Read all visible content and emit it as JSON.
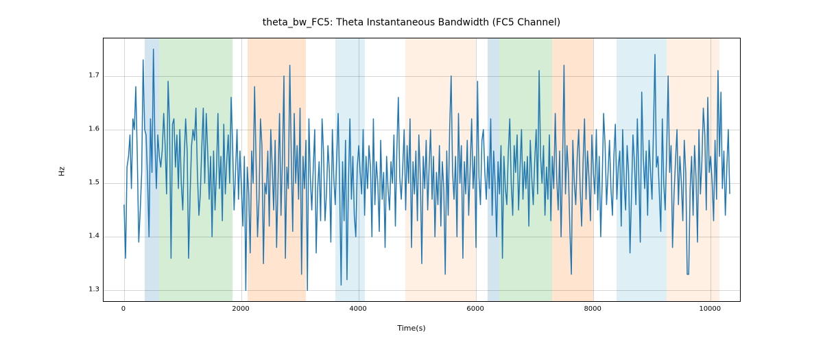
{
  "chart_data": {
    "type": "line",
    "title": "theta_bw_FC5: Theta Instantaneous Bandwidth (FC5 Channel)",
    "xlabel": "Time(s)",
    "ylabel": "Hz",
    "xlim": [
      -350,
      10500
    ],
    "ylim": [
      1.28,
      1.77
    ],
    "xticks": [
      0,
      2000,
      4000,
      6000,
      8000,
      10000
    ],
    "yticks": [
      1.3,
      1.4,
      1.5,
      1.6,
      1.7
    ],
    "bands": [
      {
        "x0": 350,
        "x1": 600,
        "color": "blue"
      },
      {
        "x0": 600,
        "x1": 1850,
        "color": "green"
      },
      {
        "x0": 2100,
        "x1": 3100,
        "color": "orange"
      },
      {
        "x0": 3600,
        "x1": 4100,
        "color": "lblue"
      },
      {
        "x0": 4800,
        "x1": 6000,
        "color": "peach"
      },
      {
        "x0": 6200,
        "x1": 6400,
        "color": "blue"
      },
      {
        "x0": 6400,
        "x1": 7300,
        "color": "green"
      },
      {
        "x0": 7300,
        "x1": 8000,
        "color": "orange"
      },
      {
        "x0": 8400,
        "x1": 9250,
        "color": "lblue"
      },
      {
        "x0": 9250,
        "x1": 10150,
        "color": "peach"
      }
    ],
    "series": [
      {
        "name": "theta_bw_FC5",
        "color": "#1f77b4",
        "x_start": 0,
        "x_step": 25,
        "values": [
          1.46,
          1.36,
          1.53,
          1.55,
          1.59,
          1.49,
          1.62,
          1.6,
          1.68,
          1.55,
          1.39,
          1.45,
          1.52,
          1.73,
          1.6,
          1.59,
          1.51,
          1.4,
          1.62,
          1.52,
          1.75,
          1.58,
          1.49,
          1.59,
          1.55,
          1.53,
          1.56,
          1.63,
          1.57,
          1.48,
          1.69,
          1.61,
          1.36,
          1.61,
          1.62,
          1.53,
          1.59,
          1.49,
          1.6,
          1.5,
          1.45,
          1.55,
          1.62,
          1.56,
          1.36,
          1.48,
          1.57,
          1.6,
          1.58,
          1.64,
          1.52,
          1.44,
          1.48,
          1.57,
          1.64,
          1.5,
          1.63,
          1.56,
          1.47,
          1.55,
          1.4,
          1.56,
          1.45,
          1.52,
          1.63,
          1.49,
          1.55,
          1.43,
          1.61,
          1.48,
          1.54,
          1.59,
          1.5,
          1.66,
          1.57,
          1.45,
          1.52,
          1.6,
          1.47,
          1.56,
          1.49,
          1.42,
          1.55,
          1.3,
          1.53,
          1.48,
          1.37,
          1.56,
          1.5,
          1.68,
          1.54,
          1.4,
          1.47,
          1.62,
          1.57,
          1.35,
          1.5,
          1.48,
          1.56,
          1.42,
          1.6,
          1.53,
          1.45,
          1.58,
          1.38,
          1.51,
          1.63,
          1.44,
          1.55,
          1.7,
          1.36,
          1.53,
          1.49,
          1.72,
          1.55,
          1.41,
          1.63,
          1.5,
          1.57,
          1.47,
          1.64,
          1.33,
          1.55,
          1.49,
          1.58,
          1.3,
          1.62,
          1.51,
          1.45,
          1.53,
          1.6,
          1.37,
          1.49,
          1.54,
          1.43,
          1.62,
          1.56,
          1.43,
          1.48,
          1.57,
          1.52,
          1.39,
          1.6,
          1.51,
          1.46,
          1.55,
          1.63,
          1.49,
          1.31,
          1.54,
          1.43,
          1.58,
          1.32,
          1.5,
          1.62,
          1.47,
          1.55,
          1.44,
          1.4,
          1.53,
          1.57,
          1.52,
          1.48,
          1.6,
          1.44,
          1.55,
          1.49,
          1.57,
          1.53,
          1.4,
          1.62,
          1.46,
          1.54,
          1.5,
          1.41,
          1.58,
          1.47,
          1.52,
          1.38,
          1.55,
          1.49,
          1.45,
          1.54,
          1.5,
          1.59,
          1.42,
          1.56,
          1.66,
          1.51,
          1.47,
          1.53,
          1.6,
          1.45,
          1.57,
          1.5,
          1.62,
          1.38,
          1.54,
          1.48,
          1.56,
          1.43,
          1.59,
          1.51,
          1.35,
          1.55,
          1.49,
          1.58,
          1.45,
          1.53,
          1.6,
          1.47,
          1.55,
          1.4,
          1.52,
          1.46,
          1.57,
          1.42,
          1.54,
          1.49,
          1.33,
          1.56,
          1.44,
          1.6,
          1.7,
          1.52,
          1.47,
          1.55,
          1.4,
          1.63,
          1.5,
          1.57,
          1.36,
          1.54,
          1.48,
          1.58,
          1.44,
          1.53,
          1.62,
          1.49,
          1.55,
          1.38,
          1.69,
          1.51,
          1.46,
          1.58,
          1.6,
          1.52,
          1.47,
          1.55,
          1.49,
          1.62,
          1.44,
          1.56,
          1.5,
          1.4,
          1.54,
          1.48,
          1.57,
          1.36,
          1.55,
          1.49,
          1.46,
          1.56,
          1.62,
          1.5,
          1.44,
          1.57,
          1.52,
          1.59,
          1.45,
          1.53,
          1.6,
          1.47,
          1.54,
          1.49,
          1.55,
          1.42,
          1.58,
          1.51,
          1.46,
          1.54,
          1.6,
          1.48,
          1.71,
          1.55,
          1.5,
          1.57,
          1.44,
          1.53,
          1.47,
          1.59,
          1.43,
          1.55,
          1.49,
          1.63,
          1.51,
          1.45,
          1.56,
          1.4,
          1.54,
          1.72,
          1.48,
          1.57,
          1.52,
          1.41,
          1.33,
          1.58,
          1.5,
          1.46,
          1.55,
          1.6,
          1.49,
          1.42,
          1.54,
          1.62,
          1.47,
          1.56,
          1.51,
          1.43,
          1.59,
          1.52,
          1.48,
          1.6,
          1.45,
          1.55,
          1.4,
          1.5,
          1.63,
          1.57,
          1.46,
          1.52,
          1.58,
          1.49,
          1.44,
          1.55,
          1.61,
          1.47,
          1.53,
          1.56,
          1.42,
          1.6,
          1.5,
          1.45,
          1.57,
          1.52,
          1.37,
          1.48,
          1.59,
          1.54,
          1.46,
          1.62,
          1.51,
          1.39,
          1.67,
          1.55,
          1.49,
          1.56,
          1.44,
          1.58,
          1.52,
          1.47,
          1.6,
          1.74,
          1.53,
          1.55,
          1.48,
          1.41,
          1.62,
          1.5,
          1.45,
          1.56,
          1.7,
          1.52,
          1.57,
          1.38,
          1.48,
          1.54,
          1.6,
          1.46,
          1.55,
          1.5,
          1.43,
          1.58,
          1.52,
          1.33,
          1.33,
          1.49,
          1.55,
          1.44,
          1.57,
          1.51,
          1.39,
          1.6,
          1.48,
          1.54,
          1.64,
          1.59,
          1.45,
          1.66,
          1.52,
          1.55,
          1.5,
          1.43,
          1.58,
          1.47,
          1.71,
          1.55,
          1.67,
          1.49,
          1.56,
          1.44,
          1.53,
          1.6,
          1.48
        ]
      }
    ]
  }
}
